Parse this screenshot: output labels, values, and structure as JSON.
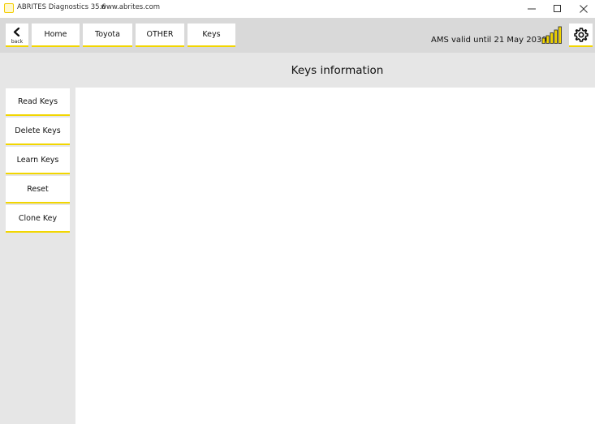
{
  "window": {
    "title": "ABRITES Diagnostics 35.6",
    "url": "www.abrites.com"
  },
  "nav": {
    "back_label": "back",
    "breadcrumb": [
      "Home",
      "Toyota",
      "OTHER",
      "Keys"
    ],
    "license_text": "AMS valid until 21 May 2030"
  },
  "page": {
    "title": "Keys information"
  },
  "sidebar": {
    "items": [
      "Read Keys",
      "Delete Keys",
      "Learn Keys",
      "Reset",
      "Clone Key"
    ]
  },
  "colors": {
    "accent": "#f2d600",
    "nav_bg": "#d9d9d9",
    "panel_bg": "#e6e6e6"
  }
}
